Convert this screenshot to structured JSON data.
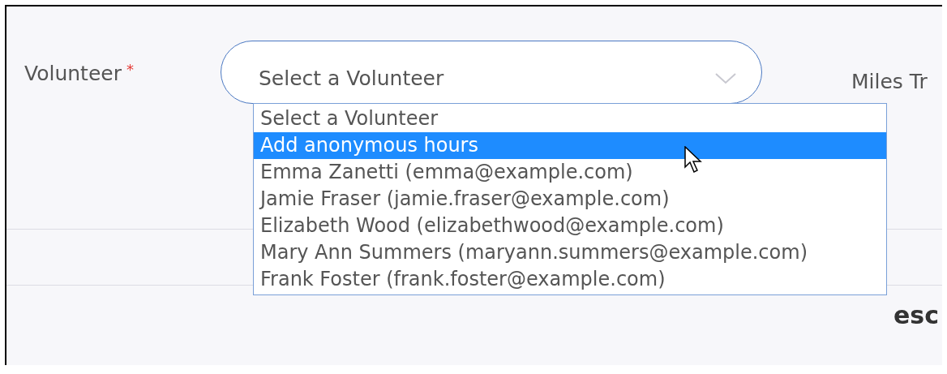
{
  "volunteer_field": {
    "label": "Volunteer",
    "required_mark": "*",
    "value": "Select a Volunteer",
    "expanded": true,
    "options": [
      {
        "label": "Select a Volunteer",
        "highlighted": false
      },
      {
        "label": "Add anonymous hours",
        "highlighted": true
      },
      {
        "label": "Emma Zanetti (emma@example.com)",
        "highlighted": false
      },
      {
        "label": "Jamie Fraser (jamie.fraser@example.com)",
        "highlighted": false
      },
      {
        "label": "Elizabeth Wood (elizabethwood@example.com)",
        "highlighted": false
      },
      {
        "label": "Mary Ann Summers (maryann.summers@example.com)",
        "highlighted": false
      },
      {
        "label": "Frank Foster (frank.foster@example.com)",
        "highlighted": false
      }
    ]
  },
  "miles_field": {
    "label": "Miles Tr"
  },
  "section_heading": "esc"
}
